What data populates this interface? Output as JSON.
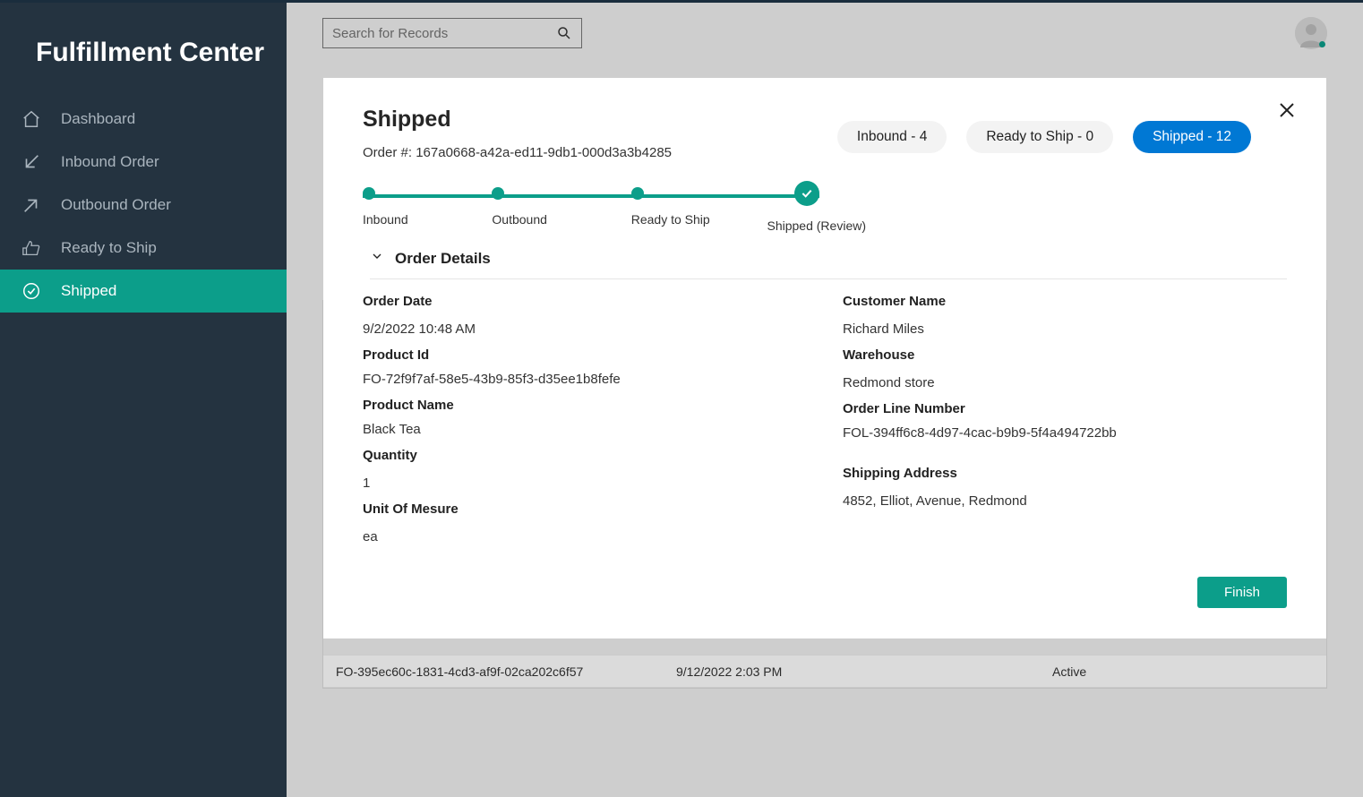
{
  "app": {
    "title": "Fulfillment Center"
  },
  "sidebar": {
    "items": [
      {
        "label": "Dashboard"
      },
      {
        "label": "Inbound Order"
      },
      {
        "label": "Outbound Order"
      },
      {
        "label": "Ready to Ship"
      },
      {
        "label": "Shipped"
      }
    ]
  },
  "search": {
    "placeholder": "Search for Records"
  },
  "bg_table": {
    "visible_row": {
      "order_id": "FO-395ec60c-1831-4cd3-af9f-02ca202c6f57",
      "date": "9/12/2022 2:03 PM",
      "status": "Active"
    }
  },
  "modal": {
    "title": "Shipped",
    "order_number_label": "Order #:",
    "order_number": "167a0668-a42a-ed11-9db1-000d3a3b4285",
    "pills": {
      "inbound": "Inbound - 4",
      "ready": "Ready to Ship - 0",
      "shipped": "Shipped - 12"
    },
    "steps": {
      "inbound": "Inbound",
      "outbound": "Outbound",
      "ready": "Ready to Ship",
      "shipped": "Shipped (Review)"
    },
    "collapse_title": "Order Details",
    "fields": {
      "order_date_label": "Order Date",
      "order_date_value": "9/2/2022 10:48 AM",
      "product_id_label": "Product Id",
      "product_id_value": "FO-72f9f7af-58e5-43b9-85f3-d35ee1b8fefe",
      "product_name_label": "Product Name",
      "product_name_value": "Black Tea",
      "quantity_label": "Quantity",
      "quantity_value": "1",
      "uom_label": "Unit Of Mesure",
      "uom_value": "ea",
      "customer_name_label": "Customer Name",
      "customer_name_value": "Richard Miles",
      "warehouse_label": "Warehouse",
      "warehouse_value": "Redmond store",
      "oln_label": "Order Line Number",
      "oln_value": "FOL-394ff6c8-4d97-4cac-b9b9-5f4a494722bb",
      "ship_addr_label": "Shipping Address",
      "ship_addr_value": "4852, Elliot, Avenue, Redmond"
    },
    "finish": "Finish"
  }
}
